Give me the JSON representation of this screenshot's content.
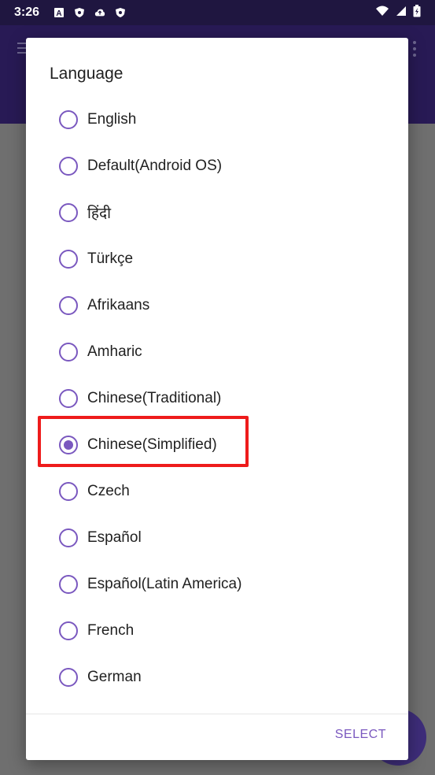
{
  "status_bar": {
    "time": "3:26",
    "notification_icons": [
      "font-icon",
      "shield-icon",
      "cloud-icon",
      "shield-icon"
    ],
    "system_icons": [
      "wifi-icon",
      "signal-icon",
      "battery-icon"
    ]
  },
  "dialog": {
    "title": "Language",
    "options": [
      {
        "label": "English",
        "selected": false
      },
      {
        "label": "Default(Android OS)",
        "selected": false
      },
      {
        "label": "हिंदी",
        "selected": false
      },
      {
        "label": "Türkçe",
        "selected": false
      },
      {
        "label": "Afrikaans",
        "selected": false
      },
      {
        "label": "Amharic",
        "selected": false
      },
      {
        "label": "Chinese(Traditional)",
        "selected": false
      },
      {
        "label": "Chinese(Simplified)",
        "selected": true
      },
      {
        "label": "Czech",
        "selected": false
      },
      {
        "label": "Español",
        "selected": false
      },
      {
        "label": "Español(Latin America)",
        "selected": false
      },
      {
        "label": "French",
        "selected": false
      },
      {
        "label": "German",
        "selected": false
      }
    ],
    "select_label": "SELECT"
  },
  "colors": {
    "accent": "#7a58bf",
    "highlight": "#ee1b1b",
    "app_bar": "#281a55",
    "status_bar": "#1f1640",
    "scrim": "#6f6f6f"
  }
}
